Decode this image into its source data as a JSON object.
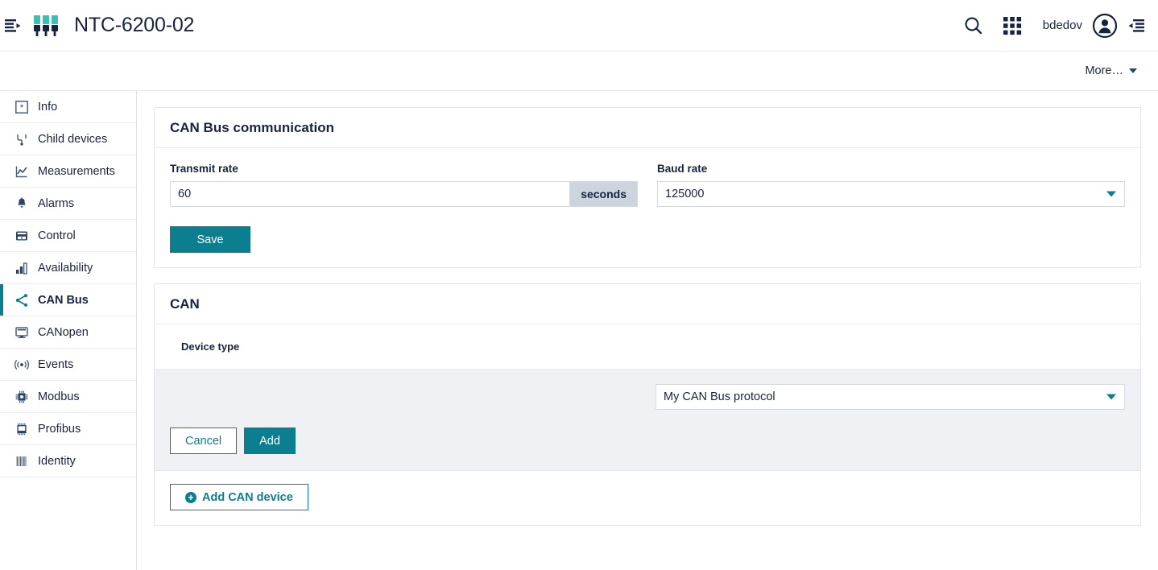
{
  "header": {
    "panel_toggle_left_icon": "panel-collapse-left-icon",
    "logo_icon": "can-connectors-logo-icon",
    "title": "NTC-6200-02",
    "search_icon": "search-icon",
    "apps_icon": "app-grid-icon",
    "user_name": "bdedov",
    "avatar_icon": "user-avatar-icon",
    "panel_toggle_right_icon": "panel-collapse-right-icon"
  },
  "sub_header": {
    "more_label": "More…",
    "more_caret_icon": "chevron-down-icon"
  },
  "sidebar": {
    "items": [
      {
        "label": "Info",
        "icon": "asterisk-icon",
        "active": false
      },
      {
        "label": "Child devices",
        "icon": "device-tree-icon",
        "active": false
      },
      {
        "label": "Measurements",
        "icon": "line-chart-icon",
        "active": false
      },
      {
        "label": "Alarms",
        "icon": "bell-icon",
        "active": false
      },
      {
        "label": "Control",
        "icon": "control-panel-icon",
        "active": false
      },
      {
        "label": "Availability",
        "icon": "bar-chart-icon",
        "active": false
      },
      {
        "label": "CAN Bus",
        "icon": "share-nodes-icon",
        "active": true
      },
      {
        "label": "CANopen",
        "icon": "monitor-icon",
        "active": false
      },
      {
        "label": "Events",
        "icon": "broadcast-icon",
        "active": false
      },
      {
        "label": "Modbus",
        "icon": "chip-icon",
        "active": false
      },
      {
        "label": "Profibus",
        "icon": "module-icon",
        "active": false
      },
      {
        "label": "Identity",
        "icon": "barcode-icon",
        "active": false
      }
    ]
  },
  "communication_card": {
    "title": "CAN Bus communication",
    "transmit_rate": {
      "label": "Transmit rate",
      "value": "60",
      "placeholder": "",
      "unit": "seconds"
    },
    "baud_rate": {
      "label": "Baud rate",
      "value": "125000",
      "caret_icon": "chevron-down-icon"
    },
    "save_label": "Save"
  },
  "can_card": {
    "title": "CAN",
    "columns": [
      "Device type"
    ],
    "rows": [],
    "new_row": {
      "protocol_value": "My CAN Bus protocol",
      "caret_icon": "chevron-down-icon",
      "cancel_label": "Cancel",
      "add_label": "Add"
    },
    "add_device_label": "Add CAN device",
    "add_device_icon": "plus-circle-icon"
  },
  "colors": {
    "accent": "#0b7f8f",
    "logo_teal": "#3cbfb4",
    "text": "#16243f",
    "row_gray": "#eff1f4",
    "addon_gray": "#ccd4de"
  }
}
